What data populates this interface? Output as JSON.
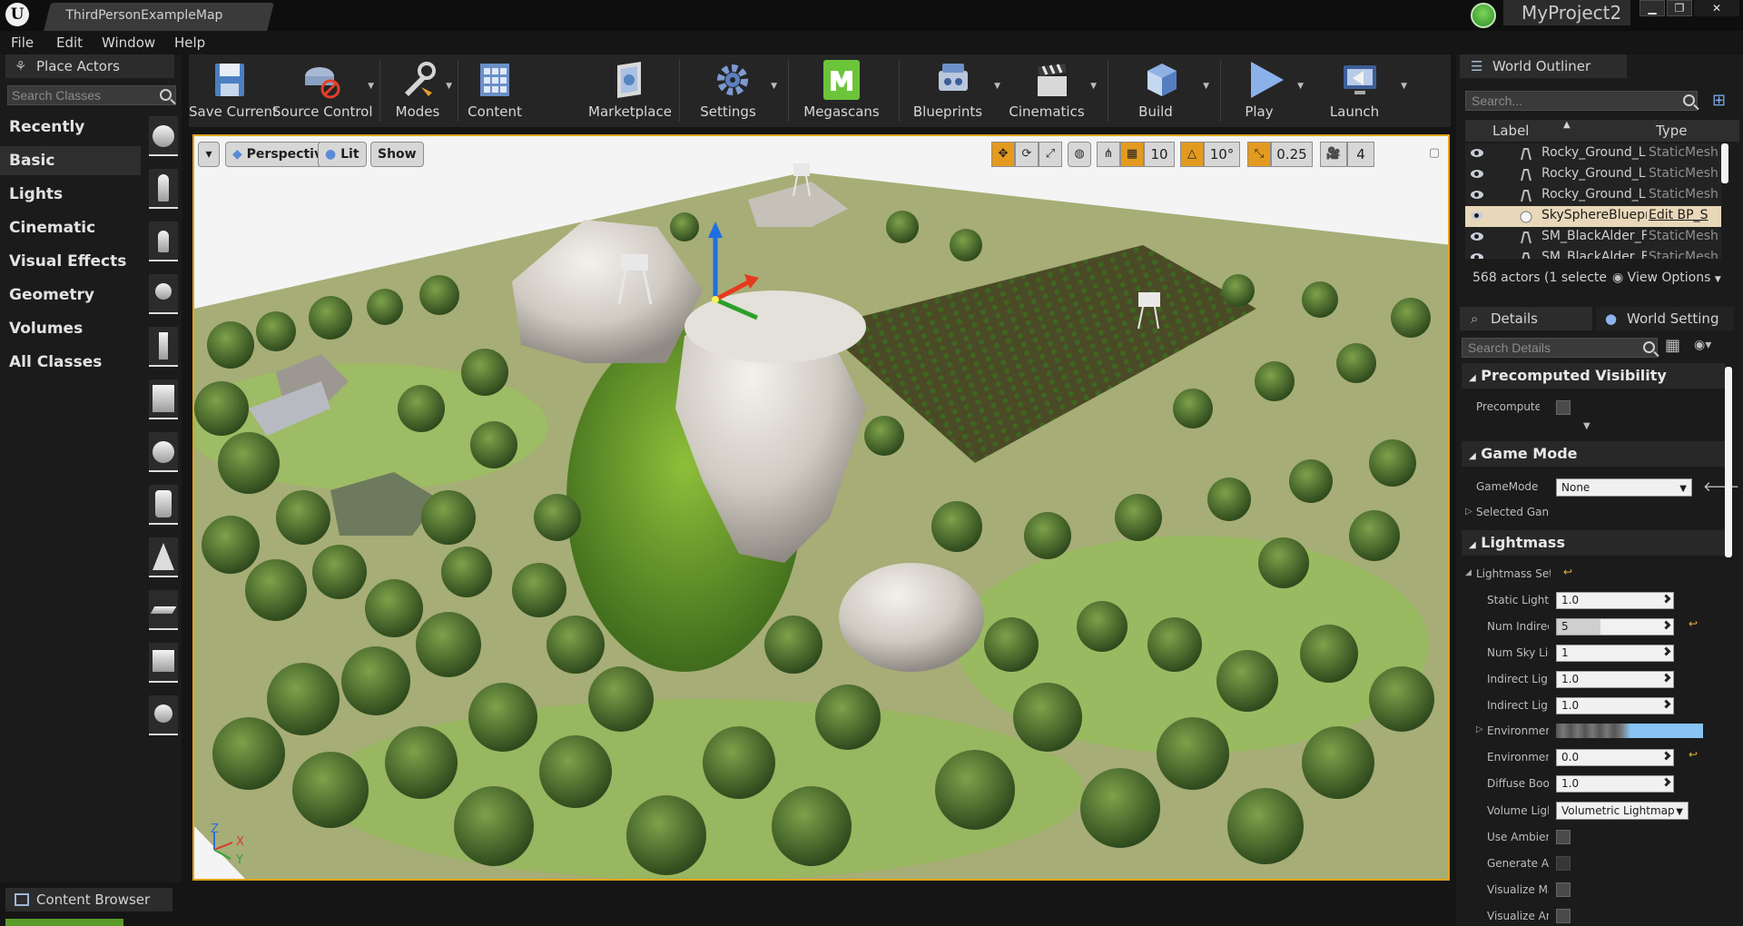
{
  "titlebar": {
    "logo": "U",
    "map_tab": "ThirdPersonExampleMap",
    "project": "MyProject2",
    "min": "▁",
    "max": "❐",
    "close": "✕"
  },
  "menu": [
    "File",
    "Edit",
    "Window",
    "Help"
  ],
  "place_actors": {
    "tab": "Place Actors",
    "search_placeholder": "Search Classes",
    "categories": [
      "Recently Placed",
      "Basic",
      "Lights",
      "Cinematic",
      "Visual Effects",
      "Geometry",
      "Volumes",
      "All Classes"
    ],
    "active_category": "Basic"
  },
  "toolbar": {
    "buttons": [
      "Save Current",
      "Source Control",
      "Modes",
      "Content",
      "Marketplace",
      "Settings",
      "Megascans",
      "Blueprints",
      "Cinematics",
      "Build",
      "Play",
      "Launch"
    ]
  },
  "viewport": {
    "perspective": "Perspective",
    "lit": "Lit",
    "show": "Show",
    "grid_snap": "10",
    "rot_snap": "10°",
    "scale_snap": "0.25",
    "cam_speed": "4",
    "axis_z": "Z",
    "axis_x": "X",
    "axis_y": "Y"
  },
  "content_browser": {
    "tab": "Content Browser"
  },
  "outliner": {
    "tab": "World Outliner",
    "search_placeholder": "Search...",
    "col_label": "Label",
    "col_type": "Type",
    "rows": [
      {
        "label": "Rocky_Ground_L",
        "type": "StaticMesh",
        "selected": false
      },
      {
        "label": "Rocky_Ground_L",
        "type": "StaticMesh",
        "selected": false
      },
      {
        "label": "Rocky_Ground_L",
        "type": "StaticMesh",
        "selected": false
      },
      {
        "label": "SkySphereBluepr",
        "type": "Edit BP_S",
        "selected": true
      },
      {
        "label": "SM_BlackAlder_F",
        "type": "StaticMesh",
        "selected": false
      },
      {
        "label": "SM_BlackAlder_F",
        "type": "StaticMesh",
        "selected": false
      }
    ],
    "status": "568 actors (1 selecte",
    "view_options": "View Options"
  },
  "details": {
    "tab_details": "Details",
    "tab_world": "World Setting",
    "search_placeholder": "Search Details",
    "sections": {
      "precomputed": "Precomputed Visibility",
      "game_mode": "Game Mode",
      "lightmass": "Lightmass"
    },
    "props": {
      "precompute_v": "Precompute V",
      "gamemode_o": "GameMode O",
      "gamemode_value": "None",
      "selected_gan": "Selected Gan",
      "lightmass_set": "Lightmass Set",
      "static_lighti": "Static Lighti",
      "static_lighti_val": "1.0",
      "num_indirec": "Num Indirec",
      "num_indirec_val": "5",
      "num_sky_lig": "Num Sky Lig",
      "num_sky_lig_val": "1",
      "indirect_ligh_1": "Indirect Ligh",
      "indirect_ligh_1_val": "1.0",
      "indirect_ligh_2": "Indirect Ligh",
      "indirect_ligh_2_val": "1.0",
      "environmen_1": "Environmer",
      "environmen_2": "Environmen",
      "environmen_2_val": "0.0",
      "diffuse_boo": "Diffuse Boo:",
      "diffuse_boo_val": "1.0",
      "volume_ligh": "Volume Ligh",
      "volume_ligh_val": "Volumetric Lightmap",
      "use_ambien": "Use Ambien",
      "generate_ar": "Generate Ar",
      "visualize_ma": "Visualize Ma",
      "visualize_an": "Visualize An"
    }
  }
}
